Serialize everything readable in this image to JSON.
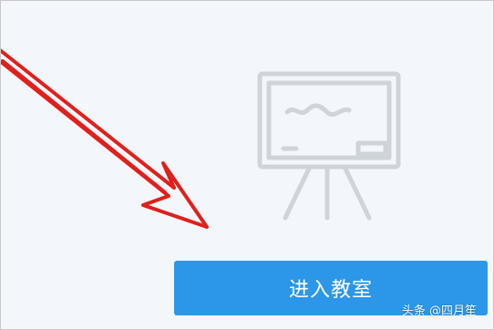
{
  "classroom": {
    "enter_button_label": "进入教室"
  },
  "watermark": {
    "text": "头条 @四月笙"
  },
  "icons": {
    "whiteboard": "whiteboard-easel-icon",
    "annotation": "red-arrow-annotation"
  },
  "colors": {
    "button": "#2c97e8",
    "background": "#f3f7fb",
    "illustration": "#cfd4d9",
    "annotation": "#e0201c"
  }
}
